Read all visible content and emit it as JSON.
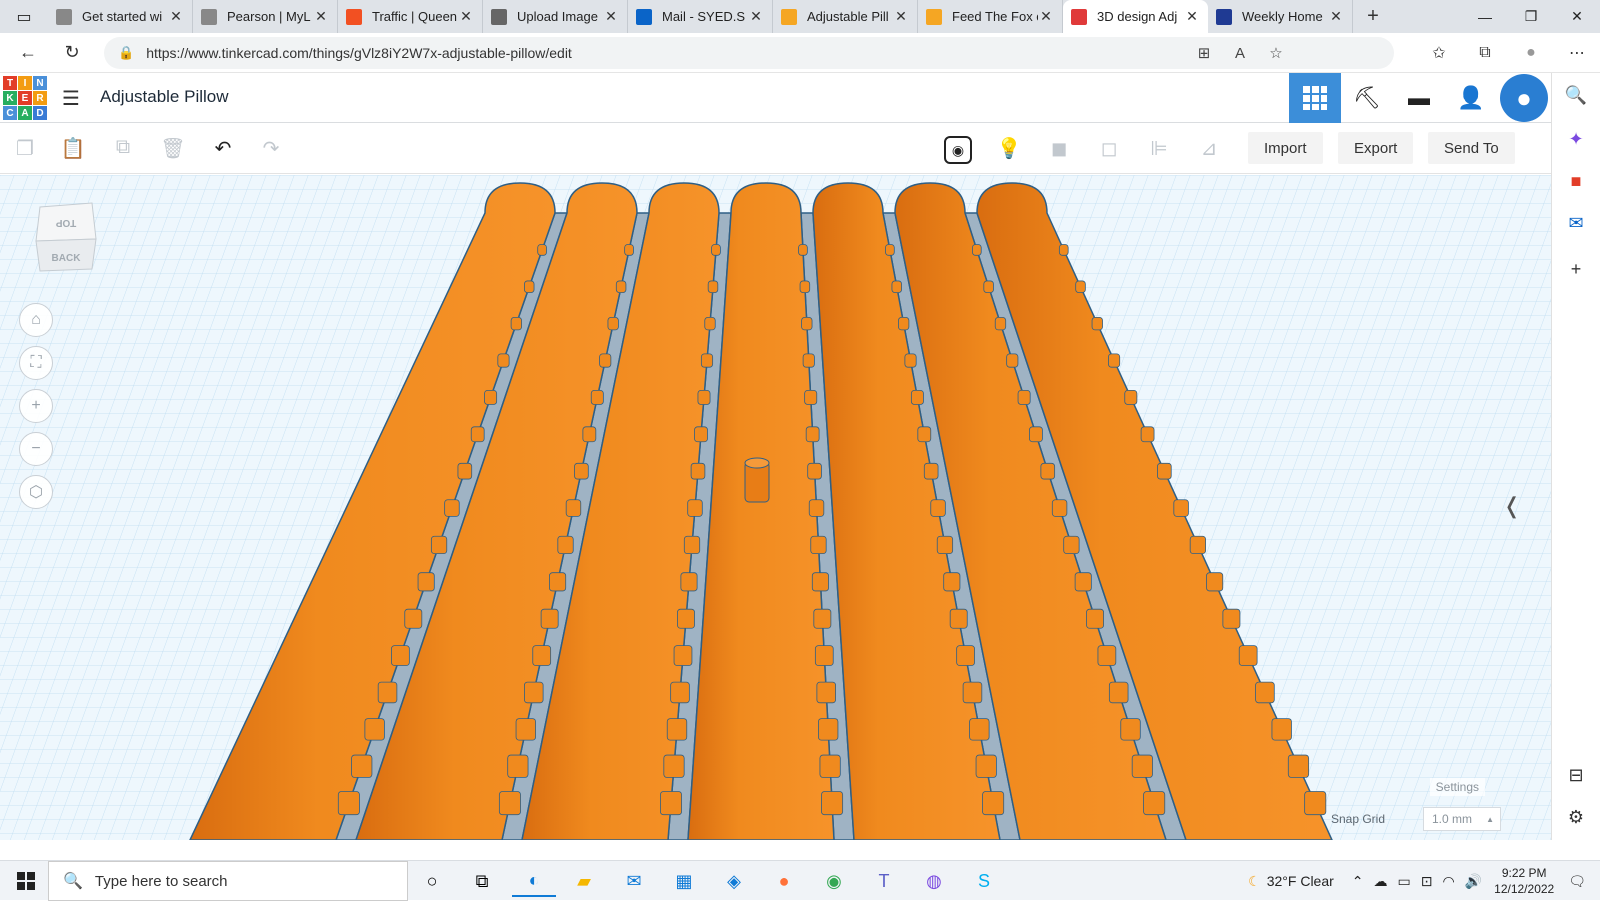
{
  "browser": {
    "tabs": [
      {
        "title": "Get started wi",
        "favicon": "page-icon",
        "color": "#888888"
      },
      {
        "title": "Pearson | MyL",
        "favicon": "page-icon",
        "color": "#888888"
      },
      {
        "title": "Traffic | Queen",
        "favicon": "microsoft-icon",
        "color": "#f25022"
      },
      {
        "title": "Upload Image",
        "favicon": "eye-icon",
        "color": "#666666"
      },
      {
        "title": "Mail - SYED.S",
        "favicon": "outlook-icon",
        "color": "#0a64c8"
      },
      {
        "title": "Adjustable Pill",
        "favicon": "instructables-icon",
        "color": "#f5a623"
      },
      {
        "title": "Feed The Fox c",
        "favicon": "instructables-icon",
        "color": "#f5a623"
      },
      {
        "title": "3D design Adj",
        "favicon": "tinkercad-icon",
        "color": "#e03a3a",
        "active": true
      },
      {
        "title": "Weekly Home",
        "favicon": "b-icon",
        "color": "#1f3a93"
      }
    ],
    "url": "https://www.tinkercad.com/things/gVlz8iY2W7x-adjustable-pillow/edit"
  },
  "tinkercad": {
    "logo_letters": [
      "T",
      "I",
      "N",
      "K",
      "E",
      "R",
      "C",
      "A",
      "D"
    ],
    "logo_colors": [
      "#e23d28",
      "#f39c12",
      "#4a90d9",
      "#27ae60",
      "#e23d28",
      "#f39c12",
      "#4a90d9",
      "#27ae60",
      "#3a7bd5"
    ],
    "design_title": "Adjustable Pillow",
    "toolbar": {
      "import_label": "Import",
      "export_label": "Export",
      "send_to_label": "Send To"
    },
    "viewcube": {
      "top": "TOP",
      "back": "BACK"
    },
    "settings_label": "Settings",
    "snap_grid_label": "Snap Grid",
    "snap_grid_value": "1.0 mm",
    "scene": {
      "pillow_count": 7,
      "pillow_color": "#f08a1e",
      "grid_color": "#b8d7ee"
    }
  },
  "taskbar": {
    "search_placeholder": "Type here to search",
    "weather": "32°F  Clear",
    "time": "9:22 PM",
    "date": "12/12/2022"
  }
}
